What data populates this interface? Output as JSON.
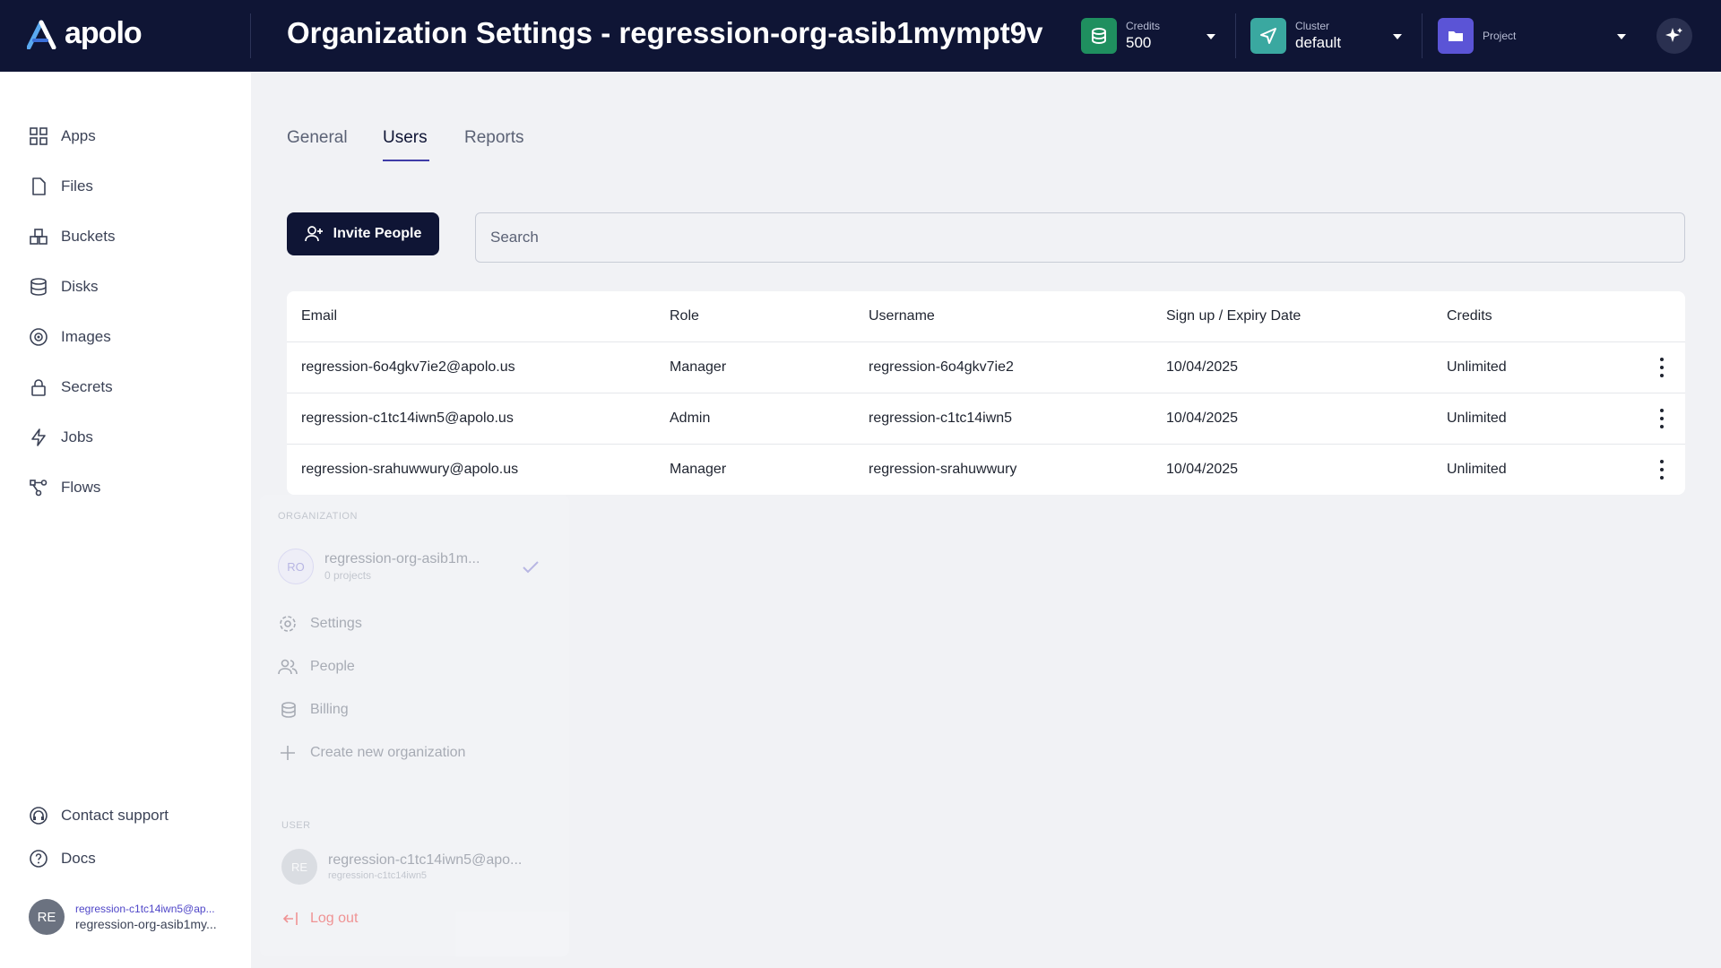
{
  "app": {
    "logo_text": "apolo"
  },
  "header": {
    "title": "Organization Settings - regression-org-asib1mympt9v",
    "credits": {
      "label": "Credits",
      "value": "500"
    },
    "cluster": {
      "label": "Cluster",
      "value": "default"
    },
    "project": {
      "label": "Project"
    }
  },
  "sidebar": {
    "items": [
      {
        "label": "Apps",
        "icon": "apps-icon"
      },
      {
        "label": "Files",
        "icon": "file-icon"
      },
      {
        "label": "Buckets",
        "icon": "bucket-icon"
      },
      {
        "label": "Disks",
        "icon": "database-icon"
      },
      {
        "label": "Images",
        "icon": "image-icon"
      },
      {
        "label": "Secrets",
        "icon": "lock-icon"
      },
      {
        "label": "Jobs",
        "icon": "bolt-icon"
      },
      {
        "label": "Flows",
        "icon": "flow-icon"
      }
    ],
    "support_label": "Contact support",
    "docs_label": "Docs",
    "user": {
      "initials": "RE",
      "email": "regression-c1tc14iwn5@ap...",
      "org": "regression-org-asib1my..."
    }
  },
  "tabs": [
    {
      "label": "General"
    },
    {
      "label": "Users"
    },
    {
      "label": "Reports"
    }
  ],
  "invite_label": "Invite People",
  "search": {
    "placeholder": "Search",
    "value": ""
  },
  "table": {
    "headers": [
      "Email",
      "Role",
      "Username",
      "Sign up / Expiry Date",
      "Credits"
    ],
    "rows": [
      {
        "email": "regression-6o4gkv7ie2@apolo.us",
        "role": "Manager",
        "username": "regression-6o4gkv7ie2",
        "date": "10/04/2025",
        "credits": "Unlimited"
      },
      {
        "email": "regression-c1tc14iwn5@apolo.us",
        "role": "Admin",
        "username": "regression-c1tc14iwn5",
        "date": "10/04/2025",
        "credits": "Unlimited"
      },
      {
        "email": "regression-srahuwwury@apolo.us",
        "role": "Manager",
        "username": "regression-srahuwwury",
        "date": "10/04/2025",
        "credits": "Unlimited"
      }
    ]
  },
  "org_menu": {
    "org_section": "ORGANIZATION",
    "org_initials": "RO",
    "org_name": "regression-org-asib1m...",
    "org_projects": "0 projects",
    "items": [
      "Settings",
      "People",
      "Billing"
    ],
    "create_label": "Create new organization",
    "user_section": "USER",
    "user_initials": "RE",
    "user_email": "regression-c1tc14iwn5@apo...",
    "user_name": "regression-c1tc14iwn5",
    "logout_label": "Log out"
  },
  "colors": {
    "topbar": "#0f1535",
    "credits_icon": "#1f8f5f",
    "cluster_icon": "#3aa8a0",
    "project_icon": "#5b54d6",
    "accent": "#3f3ca8"
  }
}
